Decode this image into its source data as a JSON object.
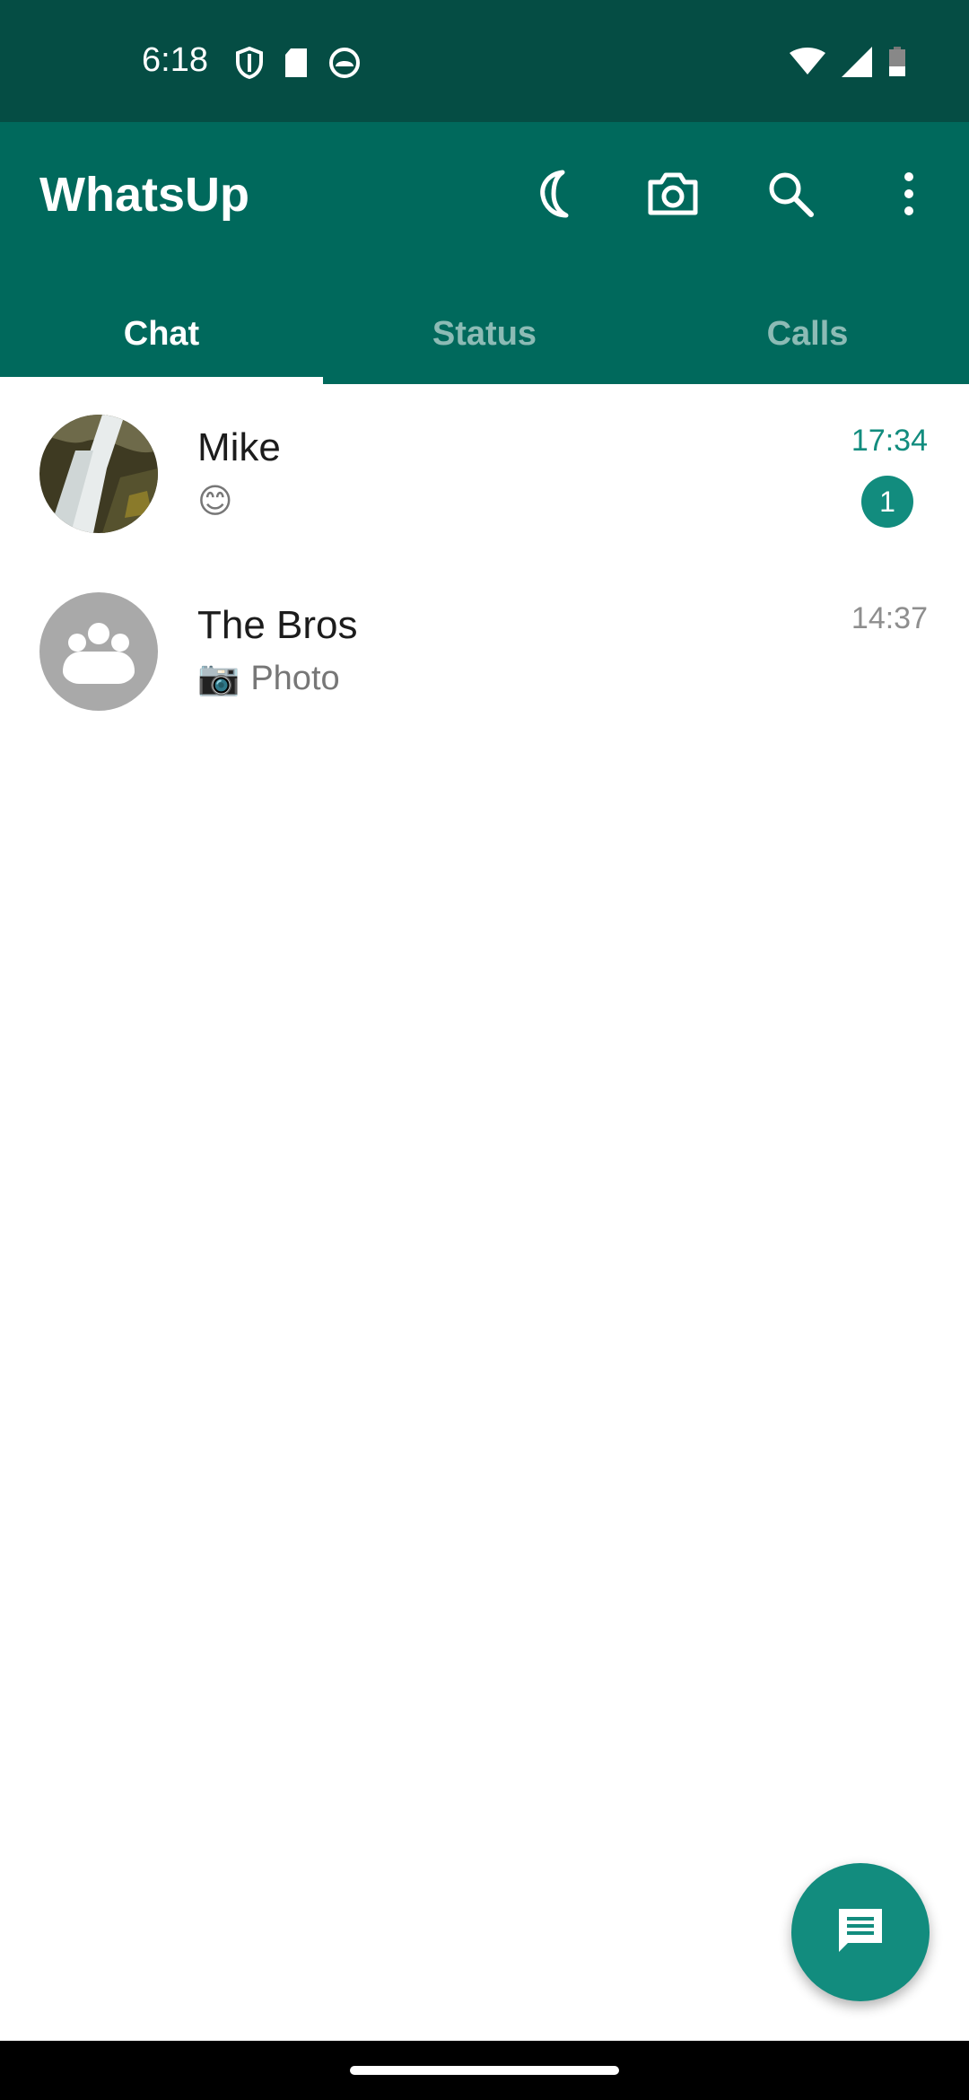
{
  "status_bar": {
    "time": "6:18",
    "left_icons": [
      "vpn-shield-icon",
      "sd-card-icon",
      "android-debug-icon"
    ],
    "right_icons": [
      "wifi-icon",
      "signal-icon",
      "battery-icon"
    ]
  },
  "app_bar": {
    "title": "WhatsUp",
    "actions": [
      "dark-mode-moon-icon",
      "camera-icon",
      "search-icon",
      "more-options-icon"
    ]
  },
  "tabs": [
    {
      "label": "Chat",
      "active": true
    },
    {
      "label": "Status",
      "active": false
    },
    {
      "label": "Calls",
      "active": false
    }
  ],
  "chats": [
    {
      "name": "Mike",
      "preview": "😊",
      "time": "17:34",
      "unread": "1",
      "avatar": "waterfall-photo"
    },
    {
      "name": "The Bros",
      "preview_icon": "📷",
      "preview": "Photo",
      "time": "14:37",
      "unread": "",
      "avatar": "group-icon"
    }
  ],
  "fab": {
    "icon": "new-chat-message-icon"
  },
  "colors": {
    "status_bar": "#054d44",
    "app_bar": "#00695c",
    "accent": "#128c7e",
    "secondary_text": "#777777"
  }
}
